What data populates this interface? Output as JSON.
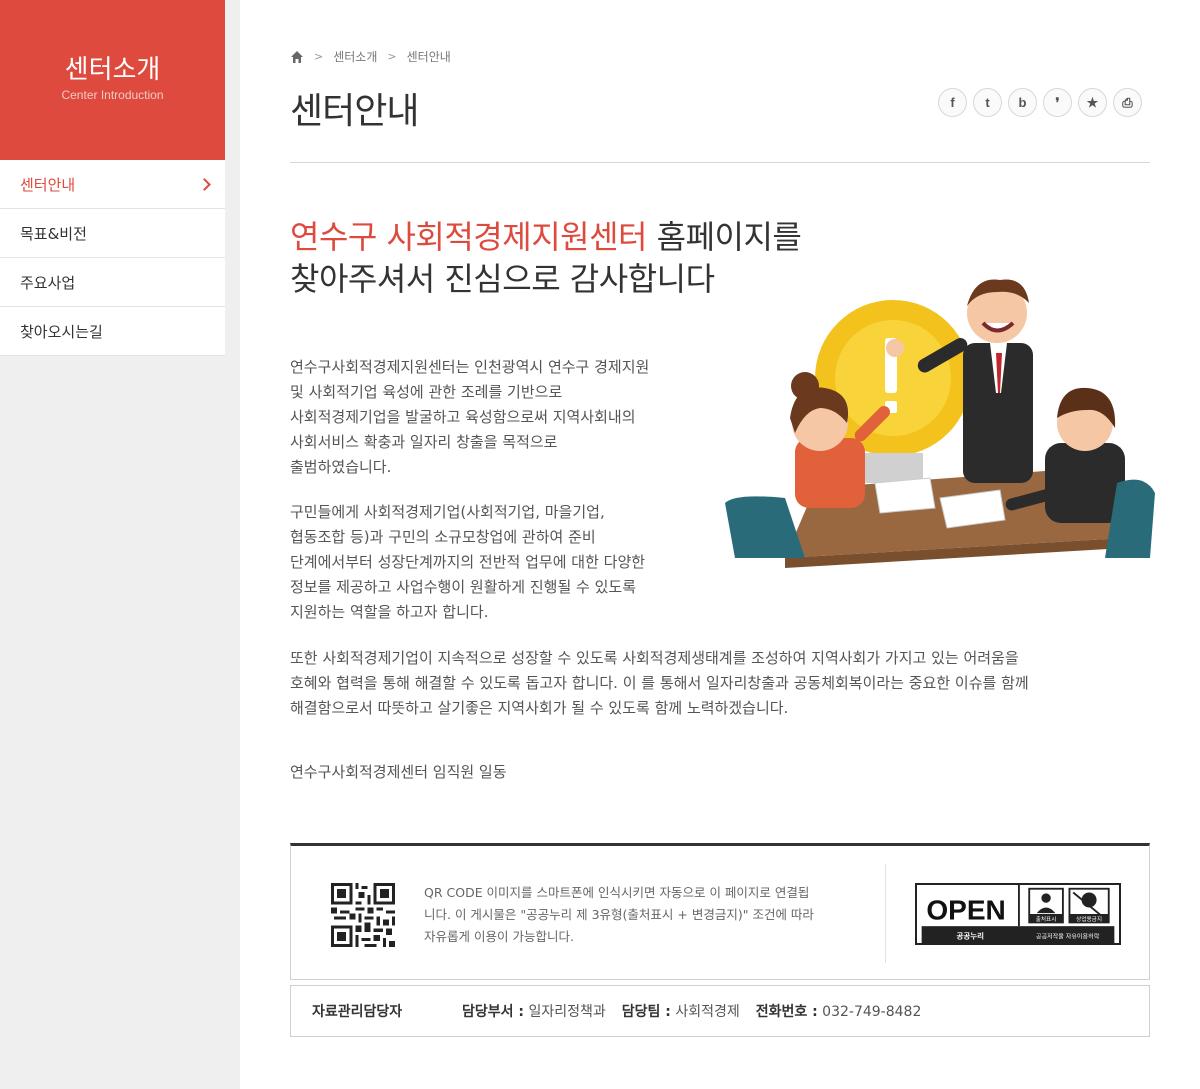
{
  "sidebar": {
    "title": "센터소개",
    "subtitle": "Center Introduction",
    "items": [
      {
        "label": "센터안내",
        "active": true
      },
      {
        "label": "목표&비전",
        "active": false
      },
      {
        "label": "주요사업",
        "active": false
      },
      {
        "label": "찾아오시는길",
        "active": false
      }
    ]
  },
  "breadcrumb": [
    "센터소개",
    "센터안내"
  ],
  "page_title": "센터안내",
  "share_icons": [
    "facebook-icon",
    "twitter-icon",
    "blog-icon",
    "story-icon",
    "bookmark-icon",
    "print-icon"
  ],
  "share_glyphs": [
    "f",
    "t",
    "b",
    "❜",
    "★",
    "⎙"
  ],
  "headline": {
    "highlight": "연수구 사회적경제지원센터",
    "rest1": " 홈페이지를",
    "line2": "찾아주셔서 진심으로 감사합니다"
  },
  "paragraphs": {
    "p1": [
      "연수구사회적경제지원센터는 인천광역시 연수구 경제지원",
      "및 사회적기업 육성에 관한 조례를 기반으로",
      "사회적경제기업을 발굴하고 육성함으로써 지역사회내의",
      "사회서비스 확충과 일자리 창출을 목적으로",
      "출범하였습니다."
    ],
    "p2": [
      "구민들에게 사회적경제기업(사회적기업, 마을기업,",
      "협동조합 등)과 구민의 소규모창업에 관하여 준비",
      "단계에서부터 성장단계까지의 전반적 업무에 대한 다양한",
      "정보를 제공하고 사업수행이 원활하게 진행될 수 있도록",
      "지원하는 역할을 하고자 합니다."
    ],
    "p3": [
      "또한 사회적경제기업이 지속적으로 성장할 수 있도록 사회적경제생태계를 조성하여 지역사회가 가지고 있는 어려움을",
      "호혜와 협력을 통해 해결할 수 있도록 돕고자 합니다. 이 를 통해서 일자리창출과 공동체회복이라는 중요한 이슈를 함께",
      "해결함으로서 따뜻하고 살기좋은 지역사회가 될 수 있도록 함께 노력하겠습니다."
    ],
    "signature": "연수구사회적경제센터 임직원 일동"
  },
  "qr_notice": [
    "QR CODE 이미지를 스마트폰에 인식시키면 자동으로 이 페이지로 연결됩",
    "니다. 이 게시물은 \"공공누리 제 3유형(출처표시 + 변경금지)\" 조건에 따라",
    "자유롭게 이용이 가능합니다."
  ],
  "open_badge": {
    "logo": "OPEN",
    "name": "공공누리",
    "tag1": "출처표시",
    "tag2": "상업용금지",
    "caption": "공공저작물 자유이용허락"
  },
  "manager": {
    "label": "자료관리담당자",
    "dept_key": "담당부서 :",
    "dept_val": "일자리정책과",
    "team_key": "담당팀 :",
    "team_val": "사회적경제",
    "phone_key": "전화번호 :",
    "phone_val": "032-749-8482"
  },
  "colors": {
    "accent": "#de4a3e",
    "sidebar_bg": "#efefef"
  }
}
